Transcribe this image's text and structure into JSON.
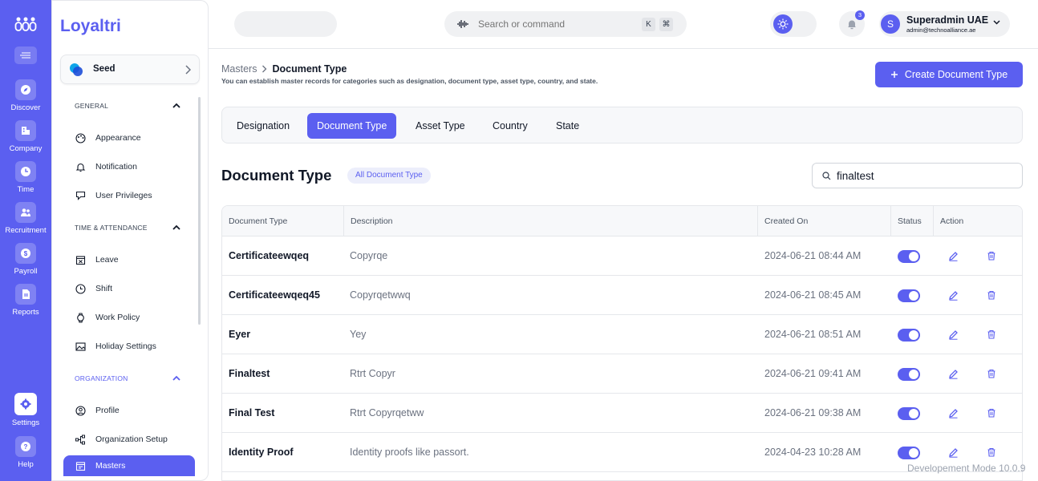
{
  "rail": {
    "items": [
      {
        "label": "Discover",
        "icon": "compass-icon"
      },
      {
        "label": "Company",
        "icon": "building-icon"
      },
      {
        "label": "Time",
        "icon": "clock-icon"
      },
      {
        "label": "Recruitment",
        "icon": "users-icon"
      },
      {
        "label": "Payroll",
        "icon": "dollar-icon"
      },
      {
        "label": "Reports",
        "icon": "document-icon"
      },
      {
        "label": "Settings",
        "icon": "gear-icon"
      },
      {
        "label": "Help",
        "icon": "question-icon"
      }
    ]
  },
  "sidebar": {
    "brand": "Loyaltri",
    "workspace": "Seed",
    "sections": [
      {
        "title": "GENERAL",
        "items": [
          "Appearance",
          "Notification",
          "User Privileges"
        ]
      },
      {
        "title": "TIME & ATTENDANCE",
        "items": [
          "Leave",
          "Shift",
          "Work Policy",
          "Holiday Settings"
        ]
      },
      {
        "title": "ORGANIZATION",
        "items": [
          "Profile",
          "Organization Setup",
          "Masters"
        ]
      }
    ],
    "active_item": "Masters"
  },
  "topbar": {
    "search_placeholder": "Search or command",
    "kbd_k": "K",
    "kbd_cmd": "⌘",
    "notification_count": "3",
    "user": {
      "initial": "S",
      "name": "Superadmin UAE",
      "email": "admin@technoalliance.ae"
    }
  },
  "main": {
    "breadcrumb": {
      "parent": "Masters",
      "current": "Document Type"
    },
    "subtitle": "You can establish master records for categories such as designation, document type, asset type, country, and state.",
    "create_button": "Create Document Type",
    "tabs": [
      "Designation",
      "Document Type",
      "Asset Type",
      "Country",
      "State"
    ],
    "active_tab": "Document Type",
    "section_title": "Document Type",
    "chip": "All Document Type",
    "search_value": "finaltest",
    "table": {
      "columns": [
        "Document Type",
        "Description",
        "Created On",
        "Status",
        "Action"
      ],
      "rows": [
        {
          "name": "Certificateewqeq",
          "description": "Copyrqe",
          "created": "2024-06-21 08:44 AM",
          "status": true
        },
        {
          "name": "Certificateewqeq45",
          "description": "Copyrqetwwq",
          "created": "2024-06-21 08:45 AM",
          "status": true
        },
        {
          "name": "Eyer",
          "description": "Yey",
          "created": "2024-06-21 08:51 AM",
          "status": true
        },
        {
          "name": "Finaltest",
          "description": "Rtrt Copyr",
          "created": "2024-06-21 09:41 AM",
          "status": true
        },
        {
          "name": "Final Test",
          "description": "Rtrt Copyrqetww",
          "created": "2024-06-21 09:38 AM",
          "status": true
        },
        {
          "name": "Identity Proof",
          "description": "Identity proofs like passort.",
          "created": "2024-04-23 10:28 AM",
          "status": true
        }
      ]
    }
  },
  "footer": {
    "dev_mode": "Developement Mode 10.0.9"
  },
  "colors": {
    "accent": "#5b5ff0"
  }
}
